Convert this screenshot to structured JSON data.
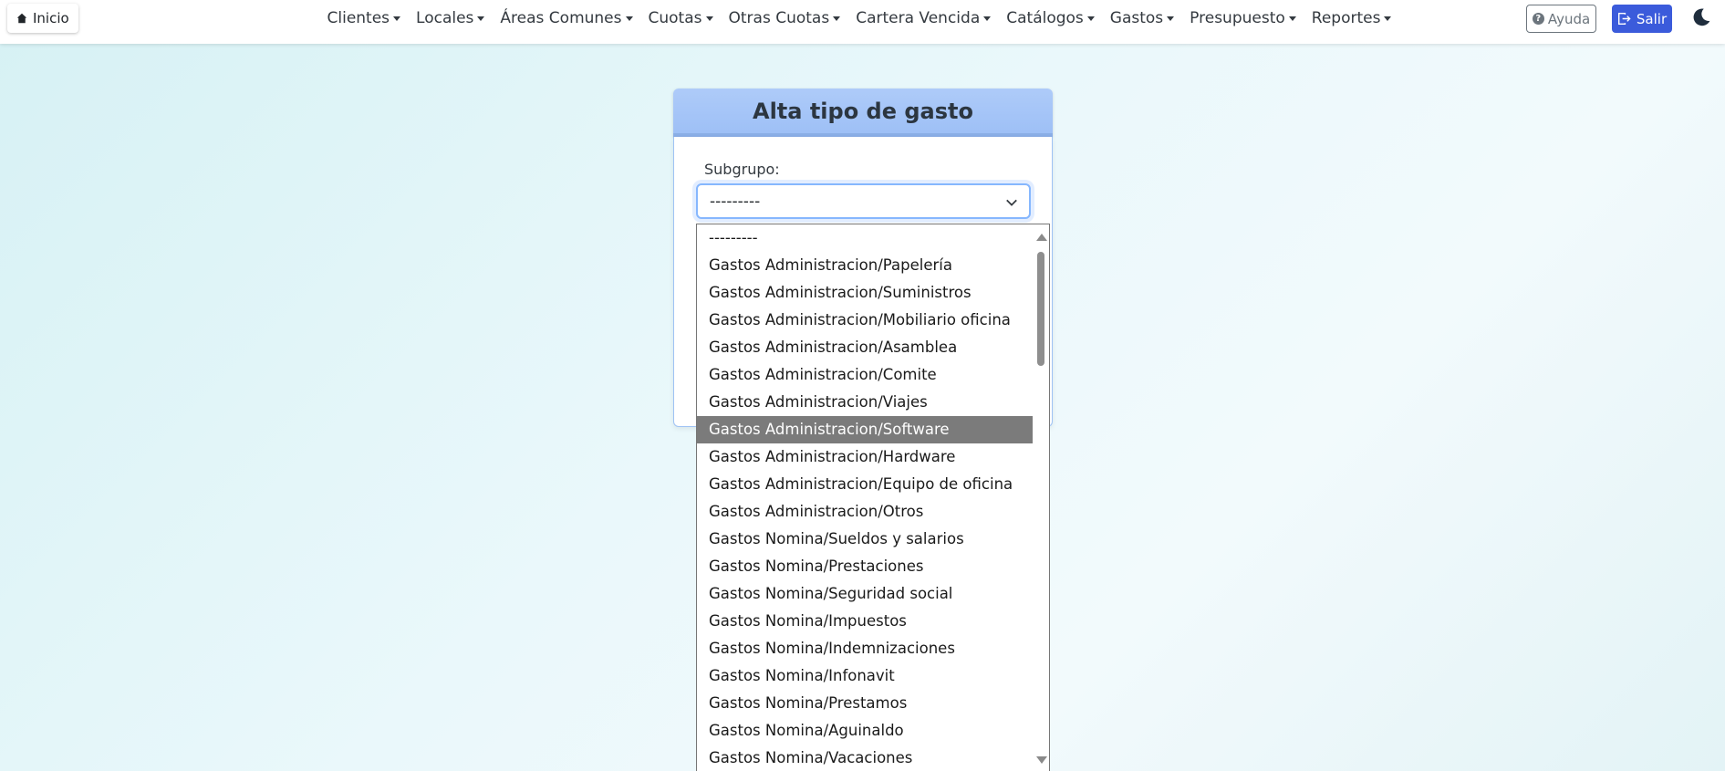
{
  "navbar": {
    "home_label": "Inicio",
    "menu": [
      {
        "label": "Clientes"
      },
      {
        "label": "Locales"
      },
      {
        "label": "Áreas Comunes"
      },
      {
        "label": "Cuotas"
      },
      {
        "label": "Otras Cuotas"
      },
      {
        "label": "Cartera Vencida"
      },
      {
        "label": "Catálogos"
      },
      {
        "label": "Gastos"
      },
      {
        "label": "Presupuesto"
      },
      {
        "label": "Reportes"
      }
    ],
    "help_label": "Ayuda",
    "logout_label": "Salir"
  },
  "form": {
    "title": "Alta tipo de gasto",
    "subgrupo_label": "Subgrupo:",
    "subgrupo_value": "---------"
  },
  "dropdown": {
    "options": [
      "---------",
      "Gastos Administracion/Papelería",
      "Gastos Administracion/Suministros",
      "Gastos Administracion/Mobiliario oficina",
      "Gastos Administracion/Asamblea",
      "Gastos Administracion/Comite",
      "Gastos Administracion/Viajes",
      "Gastos Administracion/Software",
      "Gastos Administracion/Hardware",
      "Gastos Administracion/Equipo de oficina",
      "Gastos Administracion/Otros",
      "Gastos Nomina/Sueldos y salarios",
      "Gastos Nomina/Prestaciones",
      "Gastos Nomina/Seguridad social",
      "Gastos Nomina/Impuestos",
      "Gastos Nomina/Indemnizaciones",
      "Gastos Nomina/Infonavit",
      "Gastos Nomina/Prestamos",
      "Gastos Nomina/Aguinaldo",
      "Gastos Nomina/Vacaciones"
    ],
    "highlighted": "Gastos Administracion/Software"
  }
}
